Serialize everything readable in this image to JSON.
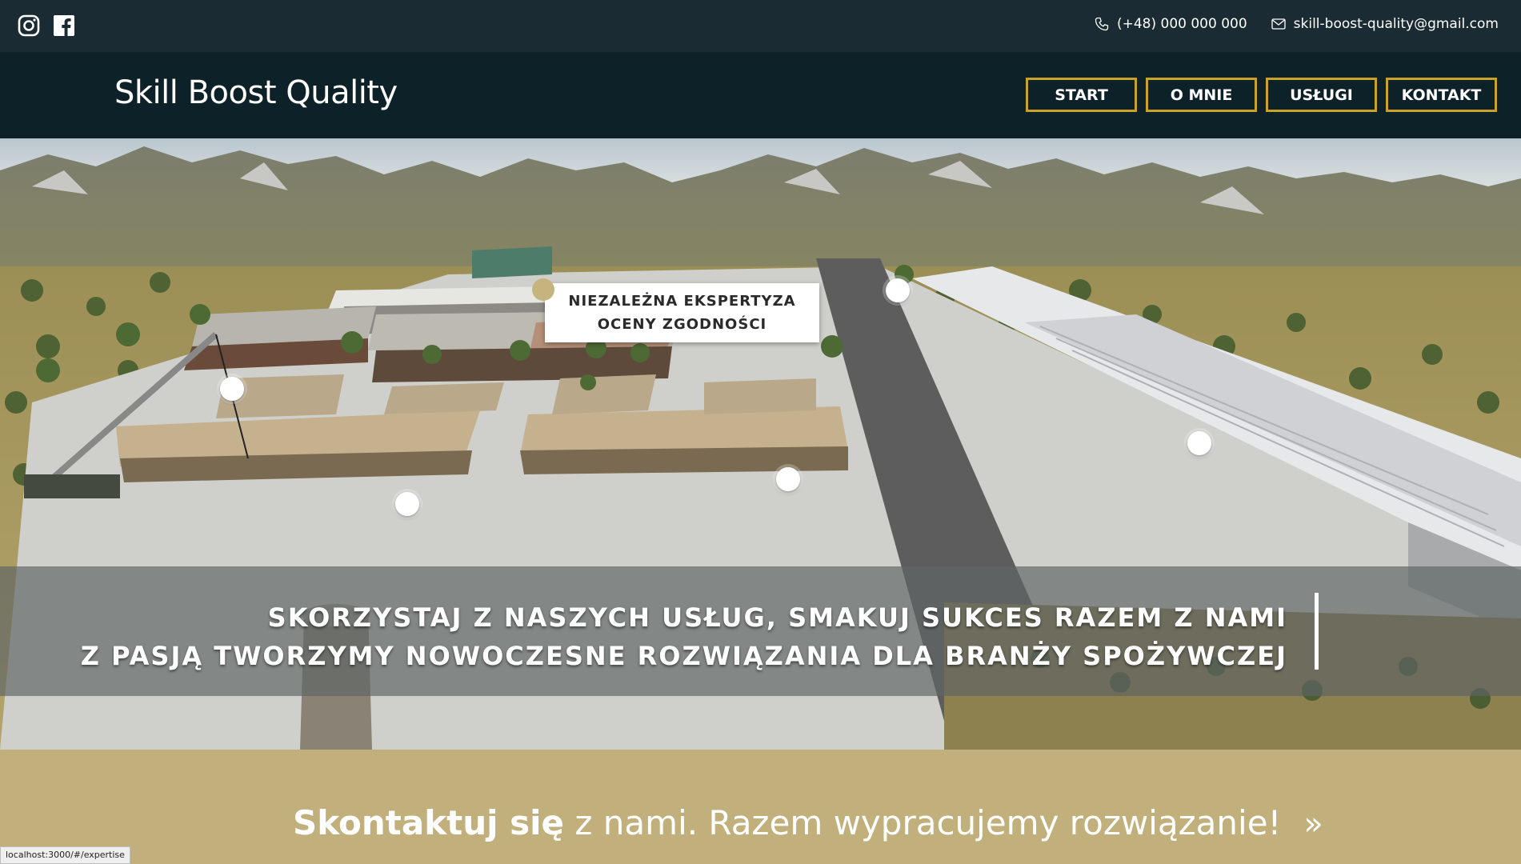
{
  "topbar": {
    "icons": [
      "instagram-icon",
      "facebook-icon"
    ],
    "phone": "(+48) 000 000 000",
    "email": "skill-boost-quality@gmail.com"
  },
  "header": {
    "brand": "Skill Boost Quality",
    "nav": [
      "START",
      "O MNIE",
      "USŁUGI",
      "KONTAKT"
    ]
  },
  "hero": {
    "card_line1": "NIEZALEŻNA EKSPERTYZA",
    "card_line2": "OCENY ZGODNOŚCI",
    "headline1": "SKORZYSTAJ Z NASZYCH USŁUG, SMAKUJ SUKCES RAZEM Z NAMI",
    "headline2": "Z PASJĄ TWORZYMY NOWOCZESNE ROZWIĄZANIA DLA BRANŻY SPOŻYWCZEJ"
  },
  "cta": {
    "strong": "Skontaktuj się",
    "light": " z nami.  Razem wypracujemy rozwiązanie!",
    "arrow": "»"
  },
  "status_url": "localhost:3000/#/expertise",
  "colors": {
    "topbar": "#1b2b33",
    "header": "#0d2128",
    "accent_border": "#c9a227",
    "cta_bg": "#c1b07b"
  }
}
